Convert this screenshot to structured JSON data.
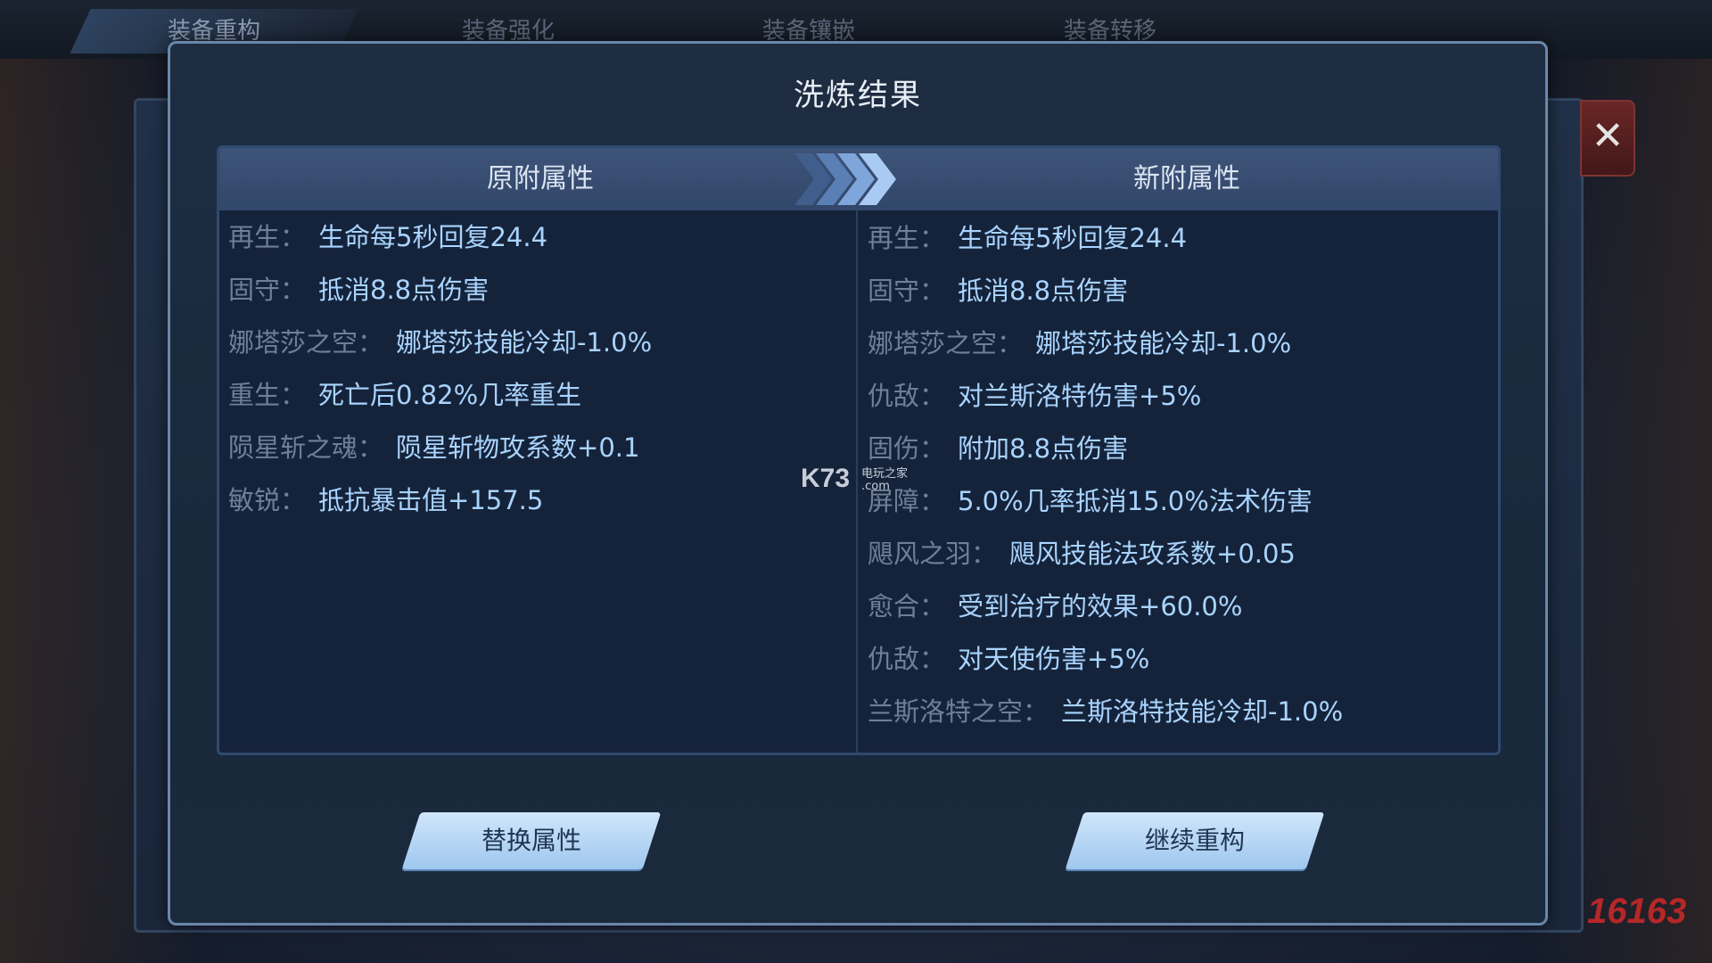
{
  "background_tabs": [
    "装备重构",
    "装备强化",
    "装备镶嵌",
    "装备转移"
  ],
  "close_icon": "close-icon",
  "dialog": {
    "title": "洗炼结果",
    "left_header": "原附属性",
    "right_header": "新附属性",
    "left_attributes": [
      {
        "label": "再生：",
        "value": "生命每5秒回复24.4"
      },
      {
        "label": "固守：",
        "value": "抵消8.8点伤害"
      },
      {
        "label": "娜塔莎之空：",
        "value": "娜塔莎技能冷却-1.0%"
      },
      {
        "label": "重生：",
        "value": "死亡后0.82%几率重生"
      },
      {
        "label": "陨星斩之魂：",
        "value": "陨星斩物攻系数+0.1"
      },
      {
        "label": "敏锐：",
        "value": "抵抗暴击值+157.5"
      }
    ],
    "right_attributes": [
      {
        "label": "再生：",
        "value": "生命每5秒回复24.4"
      },
      {
        "label": "固守：",
        "value": "抵消8.8点伤害"
      },
      {
        "label": "娜塔莎之空：",
        "value": "娜塔莎技能冷却-1.0%"
      },
      {
        "label": "仇敌：",
        "value": "对兰斯洛特伤害+5%"
      },
      {
        "label": "固伤：",
        "value": "附加8.8点伤害"
      },
      {
        "label": "屏障：",
        "value": "5.0%几率抵消15.0%法术伤害"
      },
      {
        "label": "飓风之羽：",
        "value": "飓风技能法攻系数+0.05"
      },
      {
        "label": "愈合：",
        "value": "受到治疗的效果+60.0%"
      },
      {
        "label": "仇敌：",
        "value": "对天使伤害+5%"
      },
      {
        "label": "兰斯洛特之空：",
        "value": "兰斯洛特技能冷却-1.0%"
      }
    ],
    "replace_button": "替换属性",
    "continue_button": "继续重构"
  },
  "watermarks": {
    "k73": "K73",
    "k73_sub1": "电玩之家",
    "k73_sub2": ".com",
    "site": "16163"
  }
}
